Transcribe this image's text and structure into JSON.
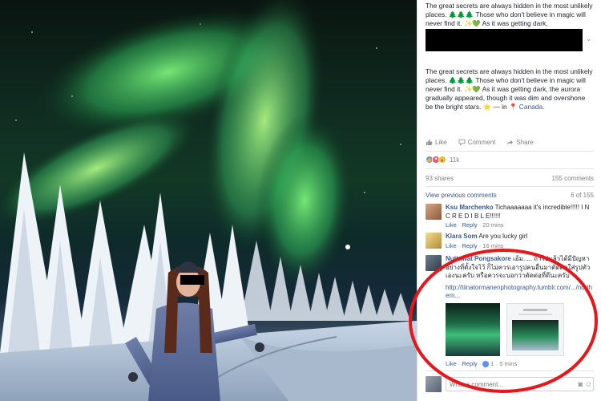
{
  "post": {
    "text_top": "The great secrets are always hidden in the most unlikely places. 🌲🌲🌲 Those who don't believe in magic will never find it. ✨💚 As it was getting dark,",
    "text_main": "The great secrets are always hidden in the most unlikely places. 🌲🌲🌲 Those who don't believe in magic will never find it. ✨💚 As it was getting dark, the aurora gradually appeared, though it was dim and overshone be the bright stars. ⭐ — in",
    "location_label": "Canada."
  },
  "actions": {
    "like": "Like",
    "comment": "Comment",
    "share": "Share"
  },
  "reactions": {
    "count": "11k"
  },
  "stats": {
    "shares": "93 shares",
    "comments": "155 comments"
  },
  "comments_nav": {
    "view_previous": "View previous comments",
    "position": "6 of 155"
  },
  "comments": [
    {
      "name": "Ksu Marchenko",
      "text": "Tichaaaaaaa it's incredible!!!!! I N C R E D I B L E!!!!!!",
      "like": "Like",
      "reply": "Reply",
      "time": "20 mins"
    },
    {
      "name": "Klara Som",
      "text": "Are you lucky girl",
      "like": "Like",
      "reply": "Reply",
      "time": "16 mins"
    },
    {
      "name": "Nuttawat Pongsakore",
      "text": "เอ้ม..... ถ้าไปแล้วได้มีปัญหาอย่างที่ตั้งใจไว้ ก็ไม่ควรเอารูปคนอื่นมาตัดต่อใส่รูปตัวเองนะครับ หรือควรจะบอกว่าตัดต่อที่ดีนะครับ",
      "url": "http://tiinatormanenphotography.tumblr.com/.../northern...",
      "like": "Like",
      "reply": "Reply",
      "reaction_count": "1",
      "time": "5 mins"
    }
  ],
  "composer": {
    "placeholder": "Write a comment..."
  },
  "colors": {
    "link": "#365899",
    "like_blue": "#5890ff",
    "love_red": "#f25268",
    "wow_yellow": "#f7b125",
    "highlight_red": "#e8161b"
  }
}
